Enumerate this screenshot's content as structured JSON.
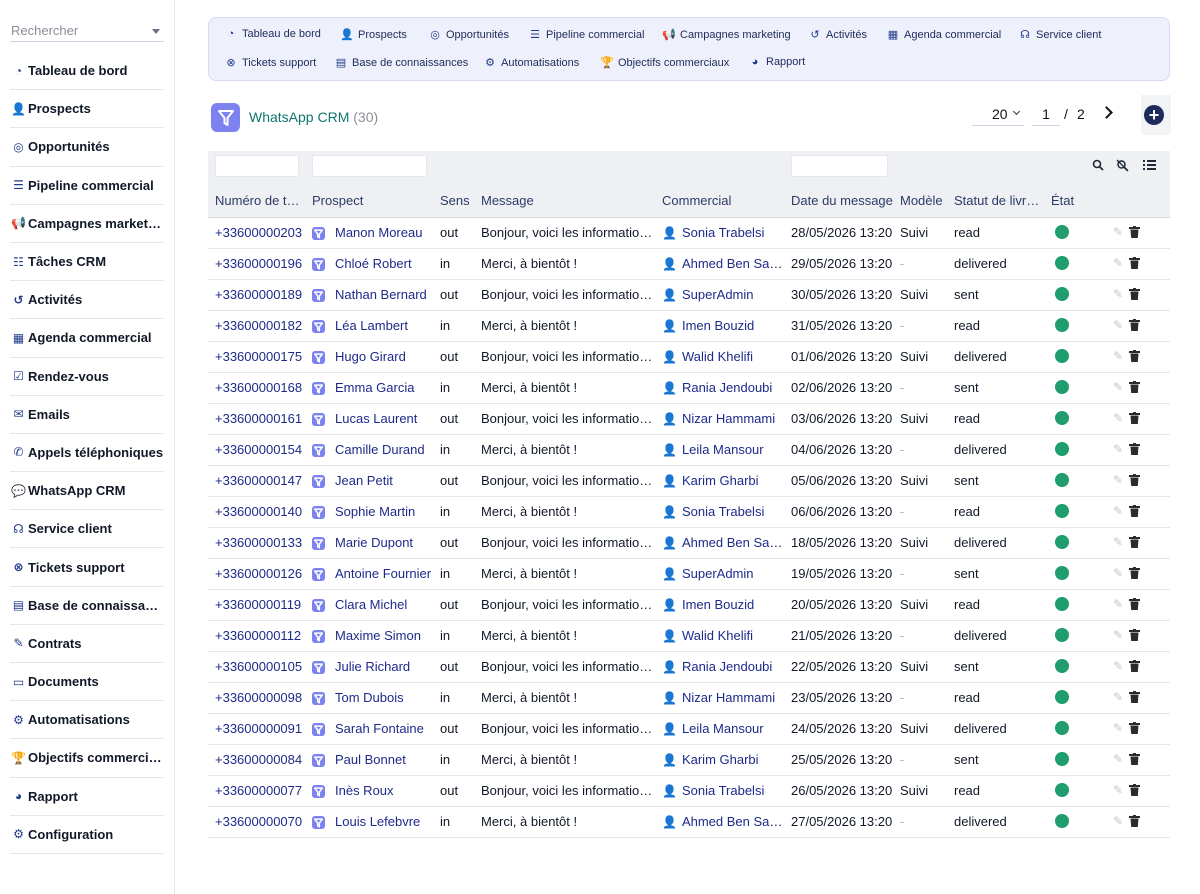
{
  "sidebar": {
    "search_placeholder": "Rechercher",
    "items": [
      {
        "label": "Tableau de bord",
        "icon": "dashboard-icon",
        "glyph": "◔"
      },
      {
        "label": "Prospects",
        "icon": "user-plus-icon",
        "glyph": "👤"
      },
      {
        "label": "Opportunités",
        "icon": "target-icon",
        "glyph": "◎"
      },
      {
        "label": "Pipeline commercial",
        "icon": "bars-icon",
        "glyph": "☰"
      },
      {
        "label": "Campagnes marketing",
        "icon": "megaphone-icon",
        "glyph": "📢"
      },
      {
        "label": "Tâches CRM",
        "icon": "task-list-icon",
        "glyph": "☷"
      },
      {
        "label": "Activités",
        "icon": "history-icon",
        "glyph": "↺"
      },
      {
        "label": "Agenda commercial",
        "icon": "calendar-icon",
        "glyph": "▦"
      },
      {
        "label": "Rendez-vous",
        "icon": "calendar-check-icon",
        "glyph": "☑"
      },
      {
        "label": "Emails",
        "icon": "envelope-icon",
        "glyph": "✉"
      },
      {
        "label": "Appels téléphoniques",
        "icon": "phone-icon",
        "glyph": "✆"
      },
      {
        "label": "WhatsApp CRM",
        "icon": "chat-icon",
        "glyph": "💬"
      },
      {
        "label": "Service client",
        "icon": "headset-icon",
        "glyph": "☊"
      },
      {
        "label": "Tickets support",
        "icon": "lifebuoy-icon",
        "glyph": "⊗"
      },
      {
        "label": "Base de connaissances",
        "icon": "book-icon",
        "glyph": "▤"
      },
      {
        "label": "Contrats",
        "icon": "file-signature-icon",
        "glyph": "✎"
      },
      {
        "label": "Documents",
        "icon": "folder-open-icon",
        "glyph": "▭"
      },
      {
        "label": "Automatisations",
        "icon": "robot-icon",
        "glyph": "⚙"
      },
      {
        "label": "Objectifs commerciaux",
        "icon": "trophy-icon",
        "glyph": "🏆"
      },
      {
        "label": "Rapport",
        "icon": "pie-chart-icon",
        "glyph": "◕"
      },
      {
        "label": "Configuration",
        "icon": "gear-icon",
        "glyph": "⚙"
      }
    ]
  },
  "topnav": {
    "items": [
      {
        "label": "Tableau de bord",
        "icon": "dashboard-icon",
        "glyph": "◔"
      },
      {
        "label": "Prospects",
        "icon": "user-plus-icon",
        "glyph": "👤"
      },
      {
        "label": "Opportunités",
        "icon": "target-icon",
        "glyph": "◎"
      },
      {
        "label": "Pipeline commercial",
        "icon": "bars-icon",
        "glyph": "☰"
      },
      {
        "label": "Campagnes marketing",
        "icon": "megaphone-icon",
        "glyph": "📢"
      },
      {
        "label": "Activités",
        "icon": "history-icon",
        "glyph": "↺"
      },
      {
        "label": "Agenda commercial",
        "icon": "calendar-icon",
        "glyph": "▦"
      },
      {
        "label": "Service client",
        "icon": "headset-icon",
        "glyph": "☊"
      },
      {
        "label": "Tickets support",
        "icon": "lifebuoy-icon",
        "glyph": "⊗"
      },
      {
        "label": "Base de connaissances",
        "icon": "book-icon",
        "glyph": "▤"
      },
      {
        "label": "Automatisations",
        "icon": "robot-icon",
        "glyph": "⚙"
      },
      {
        "label": "Objectifs commerciaux",
        "icon": "trophy-icon",
        "glyph": "🏆"
      },
      {
        "label": "Rapport",
        "icon": "pie-chart-icon",
        "glyph": "◕"
      }
    ]
  },
  "header": {
    "title": "WhatsApp CRM",
    "count": "(30)",
    "page_size": "20",
    "current_page": "1",
    "page_separator": "/",
    "total_pages": "2"
  },
  "colors": {
    "accent": "#1e2a5a",
    "title": "#0f766e",
    "status_dot": "#1f9d6f",
    "prospect_icon": "#7c83f0"
  },
  "table": {
    "columns": [
      "Numéro de téléphone",
      "Prospect",
      "Sens",
      "Message",
      "Commercial",
      "Date du message",
      "Modèle",
      "Statut de livraison",
      "État"
    ],
    "rows": [
      {
        "phone": "+33600000203",
        "prospect": "Manon Moreau",
        "sens": "out",
        "message": "Bonjour, voici les informations demandées",
        "commercial": "Sonia Trabelsi",
        "date": "28/05/2026 13:20",
        "modele": "Suivi",
        "statut": "read"
      },
      {
        "phone": "+33600000196",
        "prospect": "Chloé Robert",
        "sens": "in",
        "message": "Merci, à bientôt !",
        "commercial": "Ahmed Ben Salah",
        "date": "29/05/2026 13:20",
        "modele": "-",
        "statut": "delivered"
      },
      {
        "phone": "+33600000189",
        "prospect": "Nathan Bernard",
        "sens": "out",
        "message": "Bonjour, voici les informations demandées",
        "commercial": "SuperAdmin",
        "date": "30/05/2026 13:20",
        "modele": "Suivi",
        "statut": "sent"
      },
      {
        "phone": "+33600000182",
        "prospect": "Léa Lambert",
        "sens": "in",
        "message": "Merci, à bientôt !",
        "commercial": "Imen Bouzid",
        "date": "31/05/2026 13:20",
        "modele": "-",
        "statut": "read"
      },
      {
        "phone": "+33600000175",
        "prospect": "Hugo Girard",
        "sens": "out",
        "message": "Bonjour, voici les informations demandées",
        "commercial": "Walid Khelifi",
        "date": "01/06/2026 13:20",
        "modele": "Suivi",
        "statut": "delivered"
      },
      {
        "phone": "+33600000168",
        "prospect": "Emma Garcia",
        "sens": "in",
        "message": "Merci, à bientôt !",
        "commercial": "Rania Jendoubi",
        "date": "02/06/2026 13:20",
        "modele": "-",
        "statut": "sent"
      },
      {
        "phone": "+33600000161",
        "prospect": "Lucas Laurent",
        "sens": "out",
        "message": "Bonjour, voici les informations demandées",
        "commercial": "Nizar Hammami",
        "date": "03/06/2026 13:20",
        "modele": "Suivi",
        "statut": "read"
      },
      {
        "phone": "+33600000154",
        "prospect": "Camille Durand",
        "sens": "in",
        "message": "Merci, à bientôt !",
        "commercial": "Leila Mansour",
        "date": "04/06/2026 13:20",
        "modele": "-",
        "statut": "delivered"
      },
      {
        "phone": "+33600000147",
        "prospect": "Jean Petit",
        "sens": "out",
        "message": "Bonjour, voici les informations demandées",
        "commercial": "Karim Gharbi",
        "date": "05/06/2026 13:20",
        "modele": "Suivi",
        "statut": "sent"
      },
      {
        "phone": "+33600000140",
        "prospect": "Sophie Martin",
        "sens": "in",
        "message": "Merci, à bientôt !",
        "commercial": "Sonia Trabelsi",
        "date": "06/06/2026 13:20",
        "modele": "-",
        "statut": "read"
      },
      {
        "phone": "+33600000133",
        "prospect": "Marie Dupont",
        "sens": "out",
        "message": "Bonjour, voici les informations demandées",
        "commercial": "Ahmed Ben Salah",
        "date": "18/05/2026 13:20",
        "modele": "Suivi",
        "statut": "delivered"
      },
      {
        "phone": "+33600000126",
        "prospect": "Antoine Fournier",
        "sens": "in",
        "message": "Merci, à bientôt !",
        "commercial": "SuperAdmin",
        "date": "19/05/2026 13:20",
        "modele": "-",
        "statut": "sent"
      },
      {
        "phone": "+33600000119",
        "prospect": "Clara Michel",
        "sens": "out",
        "message": "Bonjour, voici les informations demandées",
        "commercial": "Imen Bouzid",
        "date": "20/05/2026 13:20",
        "modele": "Suivi",
        "statut": "read"
      },
      {
        "phone": "+33600000112",
        "prospect": "Maxime Simon",
        "sens": "in",
        "message": "Merci, à bientôt !",
        "commercial": "Walid Khelifi",
        "date": "21/05/2026 13:20",
        "modele": "-",
        "statut": "delivered"
      },
      {
        "phone": "+33600000105",
        "prospect": "Julie Richard",
        "sens": "out",
        "message": "Bonjour, voici les informations demandées",
        "commercial": "Rania Jendoubi",
        "date": "22/05/2026 13:20",
        "modele": "Suivi",
        "statut": "sent"
      },
      {
        "phone": "+33600000098",
        "prospect": "Tom Dubois",
        "sens": "in",
        "message": "Merci, à bientôt !",
        "commercial": "Nizar Hammami",
        "date": "23/05/2026 13:20",
        "modele": "-",
        "statut": "read"
      },
      {
        "phone": "+33600000091",
        "prospect": "Sarah Fontaine",
        "sens": "out",
        "message": "Bonjour, voici les informations demandées",
        "commercial": "Leila Mansour",
        "date": "24/05/2026 13:20",
        "modele": "Suivi",
        "statut": "delivered"
      },
      {
        "phone": "+33600000084",
        "prospect": "Paul Bonnet",
        "sens": "in",
        "message": "Merci, à bientôt !",
        "commercial": "Karim Gharbi",
        "date": "25/05/2026 13:20",
        "modele": "-",
        "statut": "sent"
      },
      {
        "phone": "+33600000077",
        "prospect": "Inès Roux",
        "sens": "out",
        "message": "Bonjour, voici les informations demandées",
        "commercial": "Sonia Trabelsi",
        "date": "26/05/2026 13:20",
        "modele": "Suivi",
        "statut": "read"
      },
      {
        "phone": "+33600000070",
        "prospect": "Louis Lefebvre",
        "sens": "in",
        "message": "Merci, à bientôt !",
        "commercial": "Ahmed Ben Salah",
        "date": "27/05/2026 13:20",
        "modele": "-",
        "statut": "delivered"
      }
    ]
  }
}
